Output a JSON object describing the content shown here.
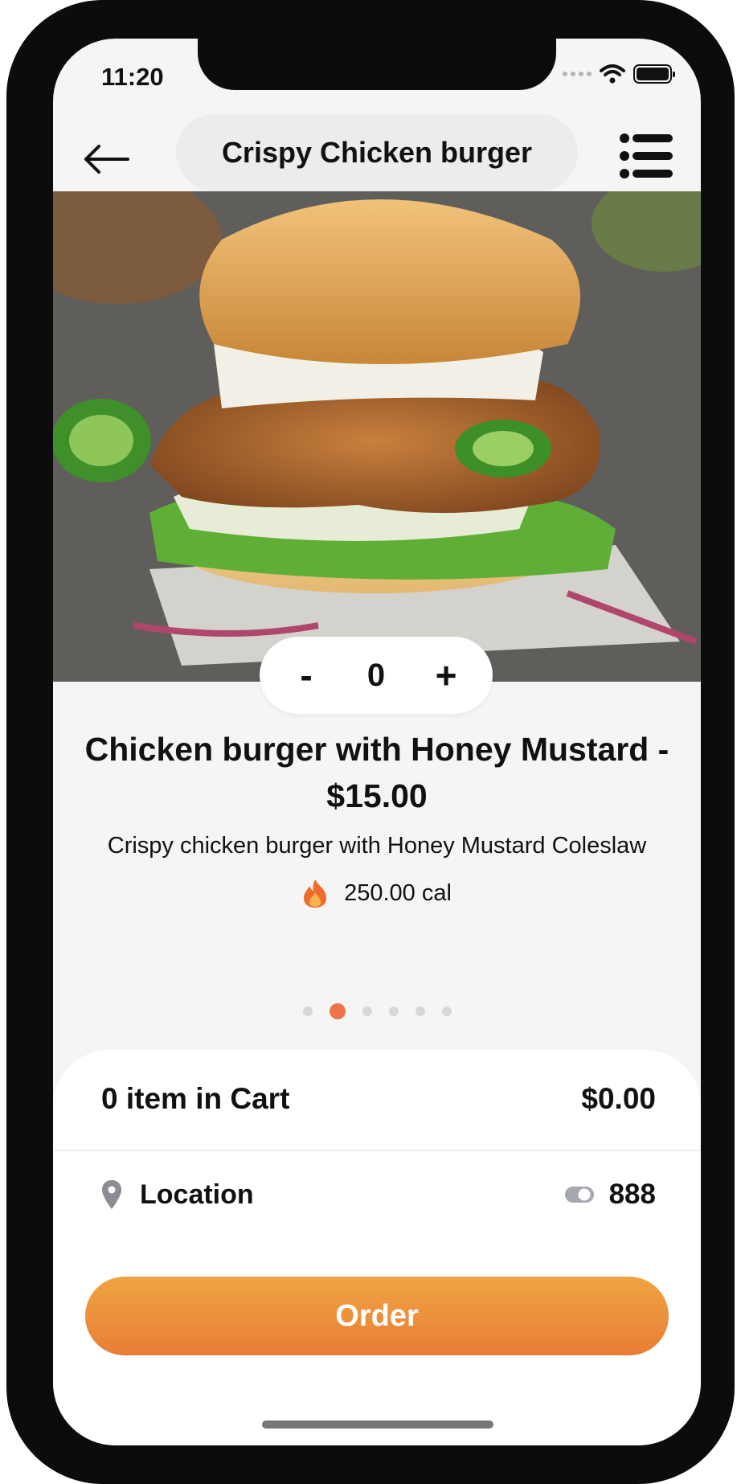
{
  "status_bar": {
    "time": "11:20"
  },
  "header": {
    "title": "Crispy Chicken burger"
  },
  "quantity": {
    "decrement_label": "-",
    "value": "0",
    "increment_label": "+"
  },
  "product": {
    "title": "Chicken burger with Honey Mustard - $15.00",
    "description": "Crispy chicken burger with Honey Mustard Coleslaw",
    "calories": "250.00 cal"
  },
  "carousel": {
    "count": 6,
    "active_index": 1
  },
  "cart": {
    "summary": "0 item in Cart",
    "total": "$0.00"
  },
  "location": {
    "label": "Location",
    "points": "888"
  },
  "order_button": {
    "label": "Order"
  },
  "colors": {
    "accent": "#ef7248",
    "order_gradient_top": "#f0a443",
    "order_gradient_bottom": "#e87e35"
  },
  "icons": [
    "back-arrow-icon",
    "list-menu-icon",
    "fire-icon",
    "location-pin-icon",
    "toggle-icon",
    "wifi-icon",
    "battery-icon"
  ]
}
